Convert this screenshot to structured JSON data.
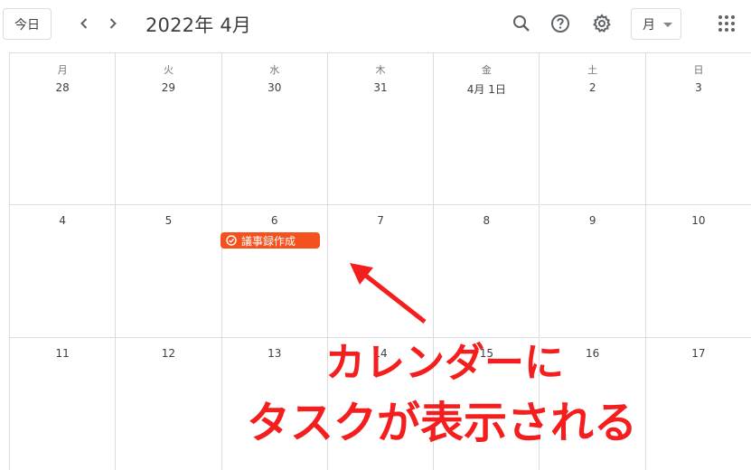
{
  "header": {
    "today_label": "今日",
    "month_title": "2022年 4月",
    "view_label": "月",
    "icons": {
      "prev": "chevron-left-icon",
      "next": "chevron-right-icon",
      "search": "search-icon",
      "help": "help-icon",
      "settings": "gear-icon",
      "apps": "apps-grid-icon"
    }
  },
  "calendar": {
    "weekdays": [
      "月",
      "火",
      "水",
      "木",
      "金",
      "土",
      "日"
    ],
    "weeks": [
      [
        "28",
        "29",
        "30",
        "31",
        "4月 1日",
        "2",
        "3"
      ],
      [
        "4",
        "5",
        "6",
        "7",
        "8",
        "9",
        "10"
      ],
      [
        "11",
        "12",
        "13",
        "14",
        "15",
        "16",
        "17"
      ]
    ],
    "event": {
      "title": "議事録作成",
      "color": "#f4511e"
    }
  },
  "annotation": {
    "line1": "カレンダーに",
    "line2": "タスクが表示される",
    "color": "#f41e1e"
  }
}
